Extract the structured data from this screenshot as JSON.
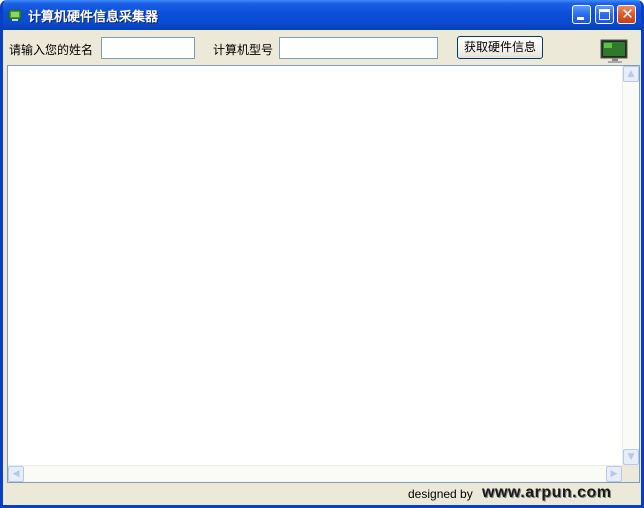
{
  "window": {
    "title": "计算机硬件信息采集器",
    "controls": {
      "minimize": "minimize",
      "maximize": "maximize",
      "close": "✕"
    }
  },
  "form": {
    "name_label": "请输入您的姓名",
    "name_value": "",
    "model_label": "计算机型号",
    "model_value": "",
    "fetch_button": "获取硬件信息"
  },
  "output": {
    "text": ""
  },
  "footer": {
    "designed_by": "designed by",
    "brand": "www.arpun.com"
  },
  "icons": {
    "app": "app-leaf-icon",
    "monitor": "monitor-icon",
    "scroll_up": "arrow-up-icon",
    "scroll_down": "arrow-down-icon",
    "scroll_left": "arrow-left-icon",
    "scroll_right": "arrow-right-icon"
  },
  "colors": {
    "titlebar": "#0a4bd4",
    "window_bg": "#ece9d8",
    "close_button": "#e0572e"
  }
}
